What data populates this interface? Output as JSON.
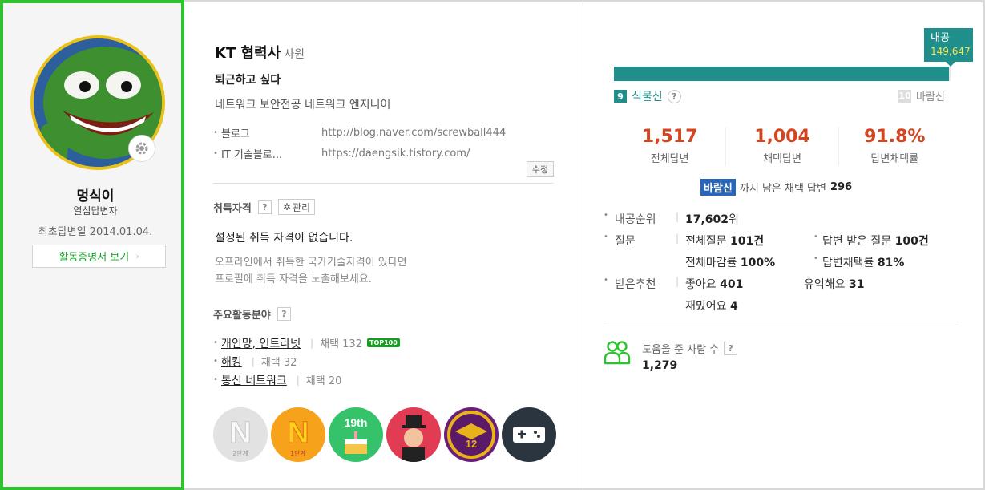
{
  "profile": {
    "nickname": "멍식이",
    "grade": "열심답변자",
    "first_answer": "최초답변일 2014.01.04.",
    "activity_button": "활동증명서 보기"
  },
  "about": {
    "company": "KT 협력사",
    "position": "사원",
    "status_message": "퇴근하고 싶다",
    "intro": "네트워크 보안전공 네트워크 엔지니어",
    "links": [
      {
        "name": "블로그",
        "url": "http://blog.naver.com/screwball444"
      },
      {
        "name": "IT 기술블로...",
        "url": "https://daengsik.tistory.com/"
      }
    ],
    "edit_label": "수정"
  },
  "certs": {
    "title": "취득자격",
    "manage_label": "관리",
    "empty_message": "설정된 취득 자격이 없습니다.",
    "help_line1": "오프라인에서 취득한 국가기술자격이 있다면",
    "help_line2": "프로필에 취득 자격을 노출해보세요."
  },
  "fields": {
    "title": "주요활동분야",
    "items": [
      {
        "name": "개인망, 인트라넷",
        "count": "채택 132",
        "badge": "TOP100"
      },
      {
        "name": "해킹",
        "count": "채택 32"
      },
      {
        "name": "통신 네트워크",
        "count": "채택 20"
      }
    ]
  },
  "badges": {
    "items": [
      {
        "icon": "naver-n-stage2-badge-icon",
        "text": "2단계"
      },
      {
        "icon": "naver-n-stage1-badge-icon",
        "text": "1단계"
      },
      {
        "icon": "birthday-19th-badge-icon",
        "text": "19th"
      },
      {
        "icon": "magician-badge-icon"
      },
      {
        "icon": "graduation-12-badge-icon",
        "text": "12"
      },
      {
        "icon": "game-controller-badge-icon"
      }
    ]
  },
  "level": {
    "power_label": "내공",
    "power_value": "149,647",
    "progress_fraction": 0.995,
    "current_num": "9",
    "current_name": "식물신",
    "next_num": "10",
    "next_name": "바람신"
  },
  "stats": [
    {
      "value": "1,517",
      "label": "전체답변"
    },
    {
      "value": "1,004",
      "label": "채택답변"
    },
    {
      "value": "91.8%",
      "label": "답변채택률"
    }
  ],
  "remain": {
    "badge": "바람신",
    "text": "까지 남은 채택 답변",
    "value": "296"
  },
  "info": {
    "rank_label": "내공순위",
    "rank_value": "17,602",
    "rank_suffix": "위",
    "question_label": "질문",
    "total_q_label": "전체질문",
    "total_q_value": "101건",
    "answered_q_label": "답변 받은 질문",
    "answered_q_value": "100건",
    "closed_label": "전체마감률",
    "closed_value": "100%",
    "adopt_rate_label": "답변채택률",
    "adopt_rate_value": "81%",
    "recommend_label": "받은추천",
    "like_label": "좋아요",
    "like_value": "401",
    "useful_label": "유익해요",
    "useful_value": "31",
    "fun_label": "재밌어요",
    "fun_value": "4"
  },
  "helpers": {
    "label": "도움을 준 사람 수",
    "count": "1,279"
  },
  "colors": {
    "green_border": "#2ec230",
    "teal": "#1e8f8a",
    "stat_red": "#d4451f",
    "blue_badge": "#2966b8"
  }
}
